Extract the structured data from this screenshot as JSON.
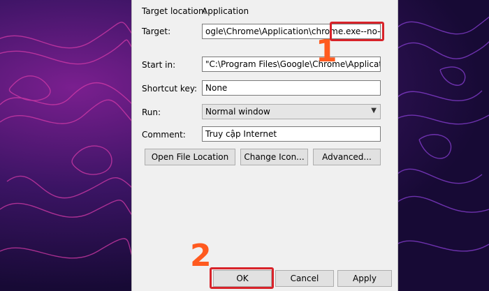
{
  "dialog": {
    "target_location": {
      "label": "Target location:",
      "value": "Application"
    },
    "target": {
      "label": "Target:",
      "value": "ogle\\Chrome\\Application\\chrome.exe",
      "suffix": "--no-sandbox"
    },
    "start_in": {
      "label": "Start in:",
      "value": "\"C:\\Program Files\\Google\\Chrome\\Application\""
    },
    "shortcut_key": {
      "label": "Shortcut key:",
      "value": "None"
    },
    "run": {
      "label": "Run:",
      "value": "Normal window"
    },
    "comment": {
      "label": "Comment:",
      "value": "Truy cập Internet"
    },
    "buttons": {
      "open_file_location": "Open File Location",
      "change_icon": "Change Icon...",
      "advanced": "Advanced..."
    },
    "footer": {
      "ok": "OK",
      "cancel": "Cancel",
      "apply": "Apply"
    }
  },
  "callouts": {
    "step1": "1",
    "step2": "2"
  },
  "colors": {
    "highlight": "#d8232a",
    "callout": "#ff5a1f",
    "background_dark": "#1a0b3a",
    "background_accent": "#7a1f8f"
  },
  "icons": {
    "run_dropdown": "chevron-down-icon"
  }
}
